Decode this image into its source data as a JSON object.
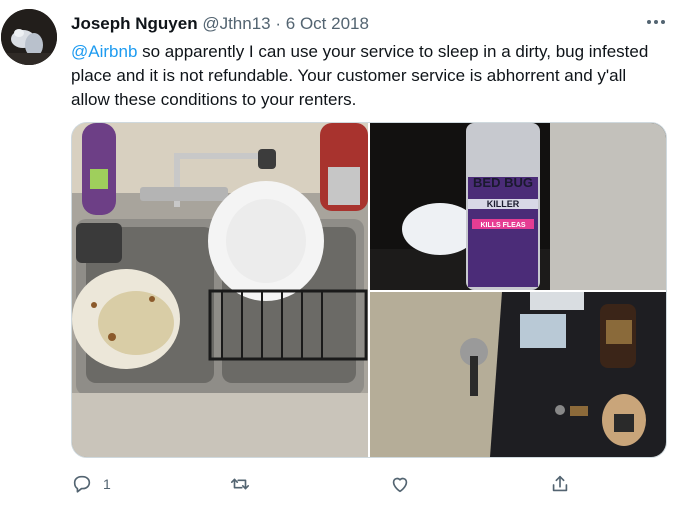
{
  "tweet": {
    "author_name": "Joseph Nguyen",
    "handle": "@Jthn13",
    "separator": "·",
    "date": "6 Oct 2018",
    "mention": "@Airbnb",
    "text": " so apparently I can use your service to sleep in a dirty, bug infested place and it is not refundable. Your customer service is abhorrent and y'all allow these conditions to your renters."
  },
  "media": {
    "photos": [
      {
        "icon": "sink-with-dishes-photo"
      },
      {
        "icon": "bed-bug-spray-photo",
        "label_top": "BED BUG",
        "label_mid": "KILLER",
        "label_band": "KILLS FLEAS"
      },
      {
        "icon": "table-with-items-photo"
      }
    ]
  },
  "actions": {
    "reply_count": "1",
    "retweet_count": "",
    "like_count": ""
  },
  "colors": {
    "link": "#1d9bf0",
    "secondary_text": "#536471",
    "border": "#cfd9de"
  }
}
